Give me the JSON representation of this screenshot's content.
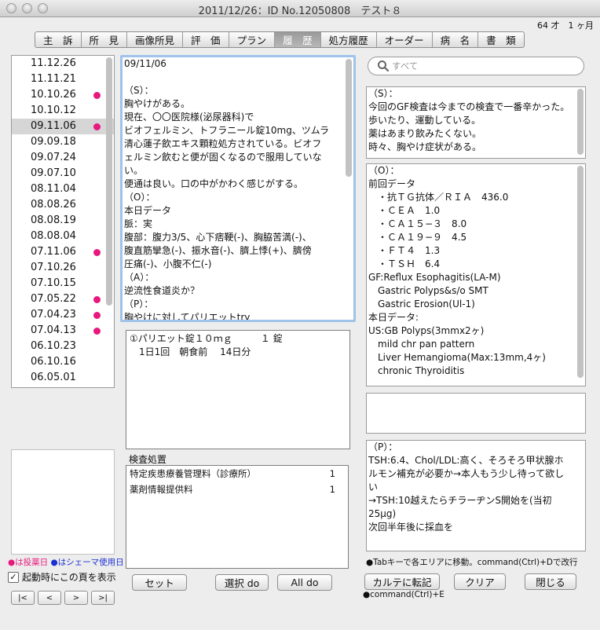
{
  "window": {
    "title": "2011/12/26：ID No.12050808　テスト８"
  },
  "header": {
    "age": "64 才　1 ヶ月"
  },
  "tabs": [
    {
      "label": "主　訴",
      "active": false
    },
    {
      "label": "所　見",
      "active": false
    },
    {
      "label": "画像所見",
      "active": false
    },
    {
      "label": "評　価",
      "active": false
    },
    {
      "label": "プラン",
      "active": false
    },
    {
      "label": "履　歴",
      "active": true
    },
    {
      "label": "処方履歴",
      "active": false
    },
    {
      "label": "オーダー",
      "active": false
    },
    {
      "label": "病　名",
      "active": false
    },
    {
      "label": "書　類",
      "active": false
    }
  ],
  "dates": [
    {
      "label": "11.12.26",
      "dot": false,
      "selected": false
    },
    {
      "label": "11.11.21",
      "dot": false,
      "selected": false
    },
    {
      "label": "10.10.26",
      "dot": true,
      "selected": false
    },
    {
      "label": "10.10.12",
      "dot": false,
      "selected": false
    },
    {
      "label": "09.11.06",
      "dot": true,
      "selected": true
    },
    {
      "label": "09.09.18",
      "dot": false,
      "selected": false
    },
    {
      "label": "09.07.24",
      "dot": false,
      "selected": false
    },
    {
      "label": "09.07.10",
      "dot": false,
      "selected": false
    },
    {
      "label": "08.11.04",
      "dot": false,
      "selected": false
    },
    {
      "label": "08.08.26",
      "dot": false,
      "selected": false
    },
    {
      "label": "08.08.19",
      "dot": false,
      "selected": false
    },
    {
      "label": "08.08.04",
      "dot": false,
      "selected": false
    },
    {
      "label": "07.11.06",
      "dot": true,
      "selected": false
    },
    {
      "label": "07.10.26",
      "dot": false,
      "selected": false
    },
    {
      "label": "07.10.15",
      "dot": false,
      "selected": false
    },
    {
      "label": "07.05.22",
      "dot": true,
      "selected": false
    },
    {
      "label": "07.04.23",
      "dot": true,
      "selected": false
    },
    {
      "label": "07.04.13",
      "dot": true,
      "selected": false
    },
    {
      "label": "06.10.23",
      "dot": false,
      "selected": false
    },
    {
      "label": "06.10.16",
      "dot": false,
      "selected": false
    },
    {
      "label": "06.05.01",
      "dot": false,
      "selected": false
    }
  ],
  "legend": {
    "pink": "●は投薬日",
    "blue": "●はシェーマ使用日"
  },
  "startup_label": "起動時にこの頁を表示",
  "nav_buttons": [
    "|<",
    "<",
    ">",
    ">|"
  ],
  "colors": {
    "dot": "#e8197e",
    "legend_blue": "#1b2fd2",
    "focus_ring": "#9fc3e9"
  },
  "memo": {
    "lines": [
      "09/11/06",
      "",
      "（S）：",
      "胸やけがある。",
      "現在、〇〇医院様(泌尿器科)で",
      "ビオフェルミン、トフラニール錠10mg、ツムラ",
      "清心蓮子飲エキス顆粒処方されている。ビオフ",
      "ェルミン飲むと便が固くなるので服用していな",
      "い。",
      "便通は良い。口の中がかわく感じがする。",
      "（O）：",
      "本日データ",
      "脈：実",
      "腹部：腹力3/5、心下痞鞕(-)、胸脇苦満(-)、",
      "腹直筋攣急(-)、振水音(-)、臍上悸(+)、臍傍",
      "圧痛(-)、小腹不仁(-)",
      "（A）：",
      "逆流性食道炎か？",
      "（P）：",
      "胸やけに対してパリエットtry"
    ]
  },
  "prescription": {
    "lines": [
      "①パリエット錠１０ｍｇ　　　１ 錠",
      "　1日1回　朝食前　 14日分"
    ]
  },
  "exam": {
    "label": "検査処置",
    "rows": [
      {
        "name": "特定疾患療養管理料（診療所）",
        "qty": "1"
      },
      {
        "name": "薬剤情報提供料",
        "qty": "1"
      }
    ]
  },
  "buttons": {
    "set": "セット",
    "select_do": "選択 do",
    "all_do": "All do",
    "karte": "カルテに転記",
    "clear": "クリア",
    "close": "閉じる"
  },
  "search": {
    "placeholder": "すべて"
  },
  "right": {
    "s_lines": [
      "（S）：",
      "今回のGF検査は今までの検査で一番辛かった。",
      "歩いたり、運動している。",
      "薬はあまり飲みたくない。",
      "時々、胸やけ症状がある。"
    ],
    "o_lines": [
      "（O）：",
      "前回データ",
      "　・抗ＴＧ抗体／ＲＩＡ　436.0",
      "　・ＣＥＡ　1.0",
      "　・ＣＡ１５−３　8.0",
      "　・ＣＡ１９−９　4.5",
      "　・ＦＴ４　1.3",
      "　・ＴＳＨ　6.4",
      "GF:Reflux Esophagitis(LA-M)",
      "　Gastric Polyps&s/o SMT",
      "　Gastric Erosion(Ul-1)",
      "本日データ:",
      "US:GB Polyps(3mmx2ヶ)",
      "　mild chr pan pattern",
      "　Liver Hemangioma(Max:13mm,4ヶ)",
      "　chronic Thyroiditis"
    ],
    "p_lines": [
      "（P）：",
      "TSH:6.4、Chol/LDL:高く、そろそろ甲状腺ホ",
      "ルモン補充が必要か→本人もう少し待って欲し",
      "い",
      "→TSH:10越えたらチラーヂンS開始を(当初",
      "25μg)",
      "次回半年後に採血を"
    ]
  },
  "hint": "●Tabキーで各エリアに移動。command(Ctrl)+Dで改行",
  "hint2": "●command(Ctrl)+E"
}
